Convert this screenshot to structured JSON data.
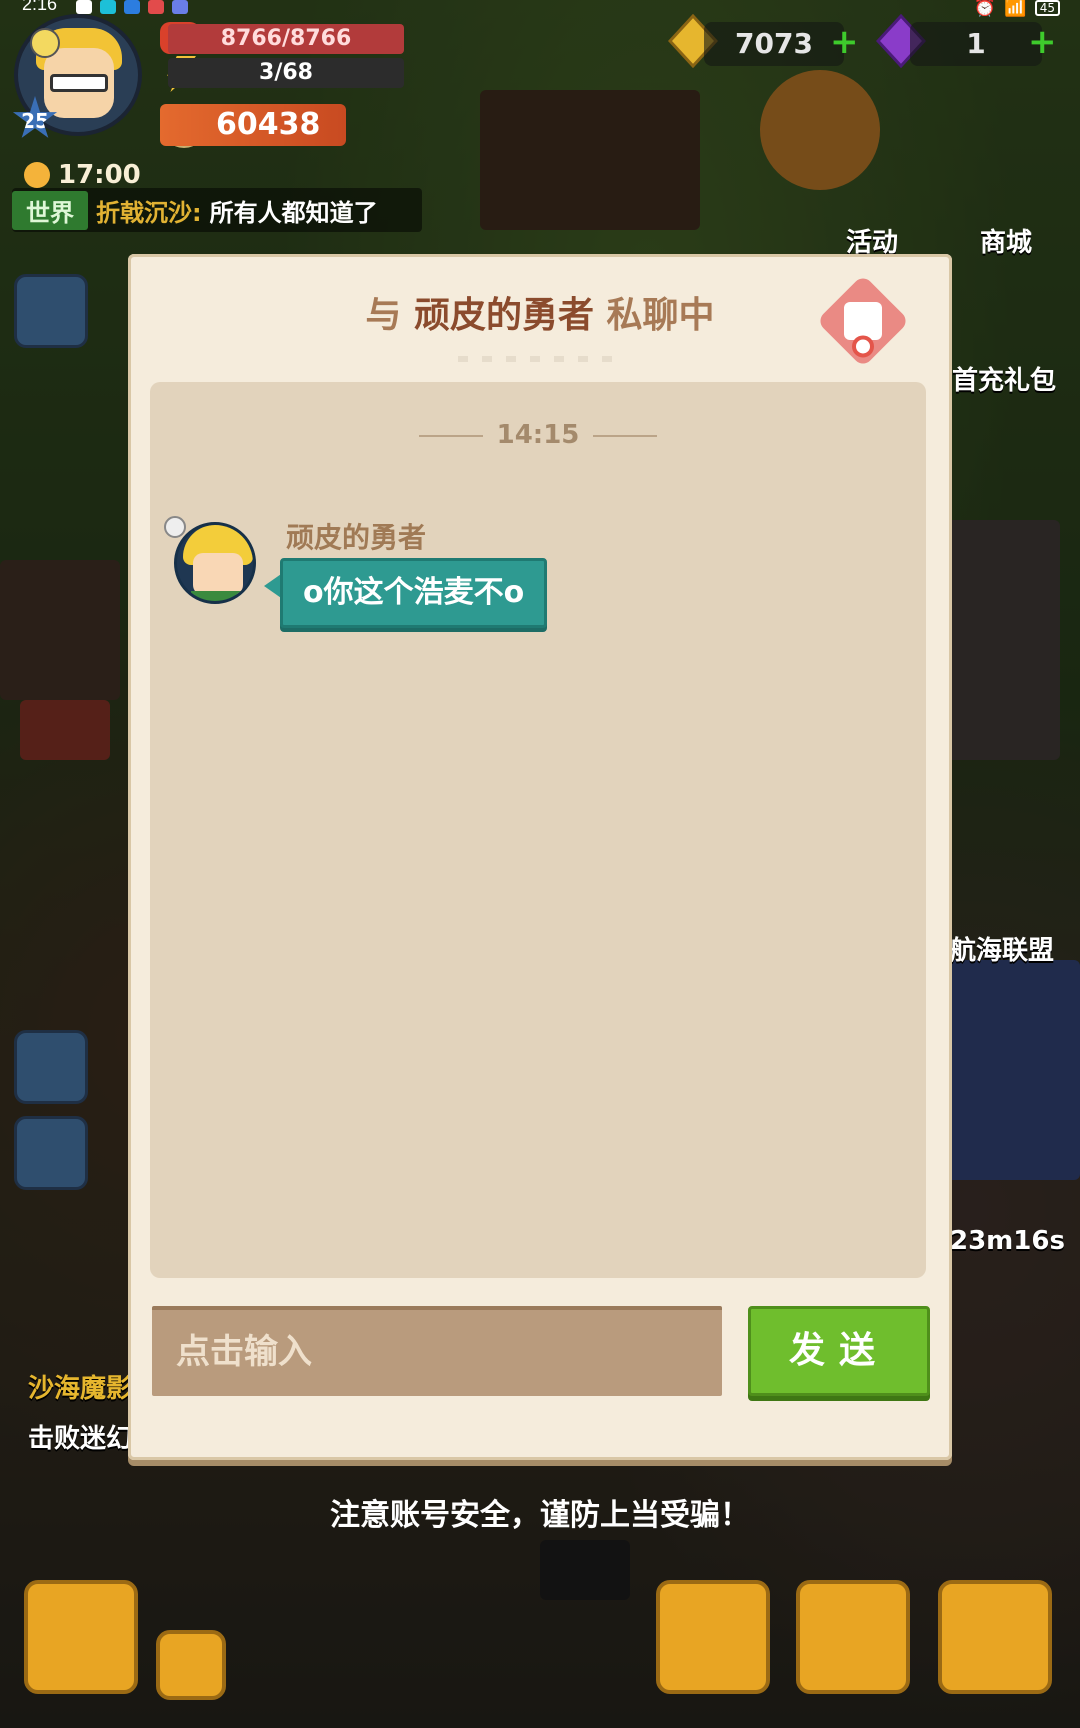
{
  "status_bar": {
    "time": "2:16",
    "battery": "45"
  },
  "hud": {
    "level": "25",
    "hp": "8766/8766",
    "energy": "3/68",
    "power": "60438",
    "clock": "17:00",
    "gold": "7073",
    "gems": "1",
    "world_chat": {
      "channel": "世界",
      "sender": "折戟沉沙:",
      "message": "所有人都知道了"
    },
    "side_labels": {
      "activity": "活动",
      "shop": "商城",
      "first_recharge": "首充礼包",
      "alliance": "航海联盟",
      "timer": "23m16s",
      "quest_title": "沙海魔影",
      "quest_desc": "击败迷幻"
    }
  },
  "chat_modal": {
    "title_prefix": "与",
    "partner_name": "顽皮的勇者",
    "title_suffix": "私聊中",
    "time_divider": "14:15",
    "messages": [
      {
        "sender": "顽皮的勇者",
        "text": "o你这个浩麦不o"
      }
    ],
    "input_placeholder": "点击输入",
    "send_label": "发送"
  },
  "warning_text": "注意账号安全，谨防上当受骗！",
  "colors": {
    "modal_bg": "#f5ecdc",
    "chat_area_bg": "#e2d3bc",
    "bubble": "#2e9a91",
    "send_button": "#6fbe2d",
    "input_bg": "#b99b7d"
  }
}
